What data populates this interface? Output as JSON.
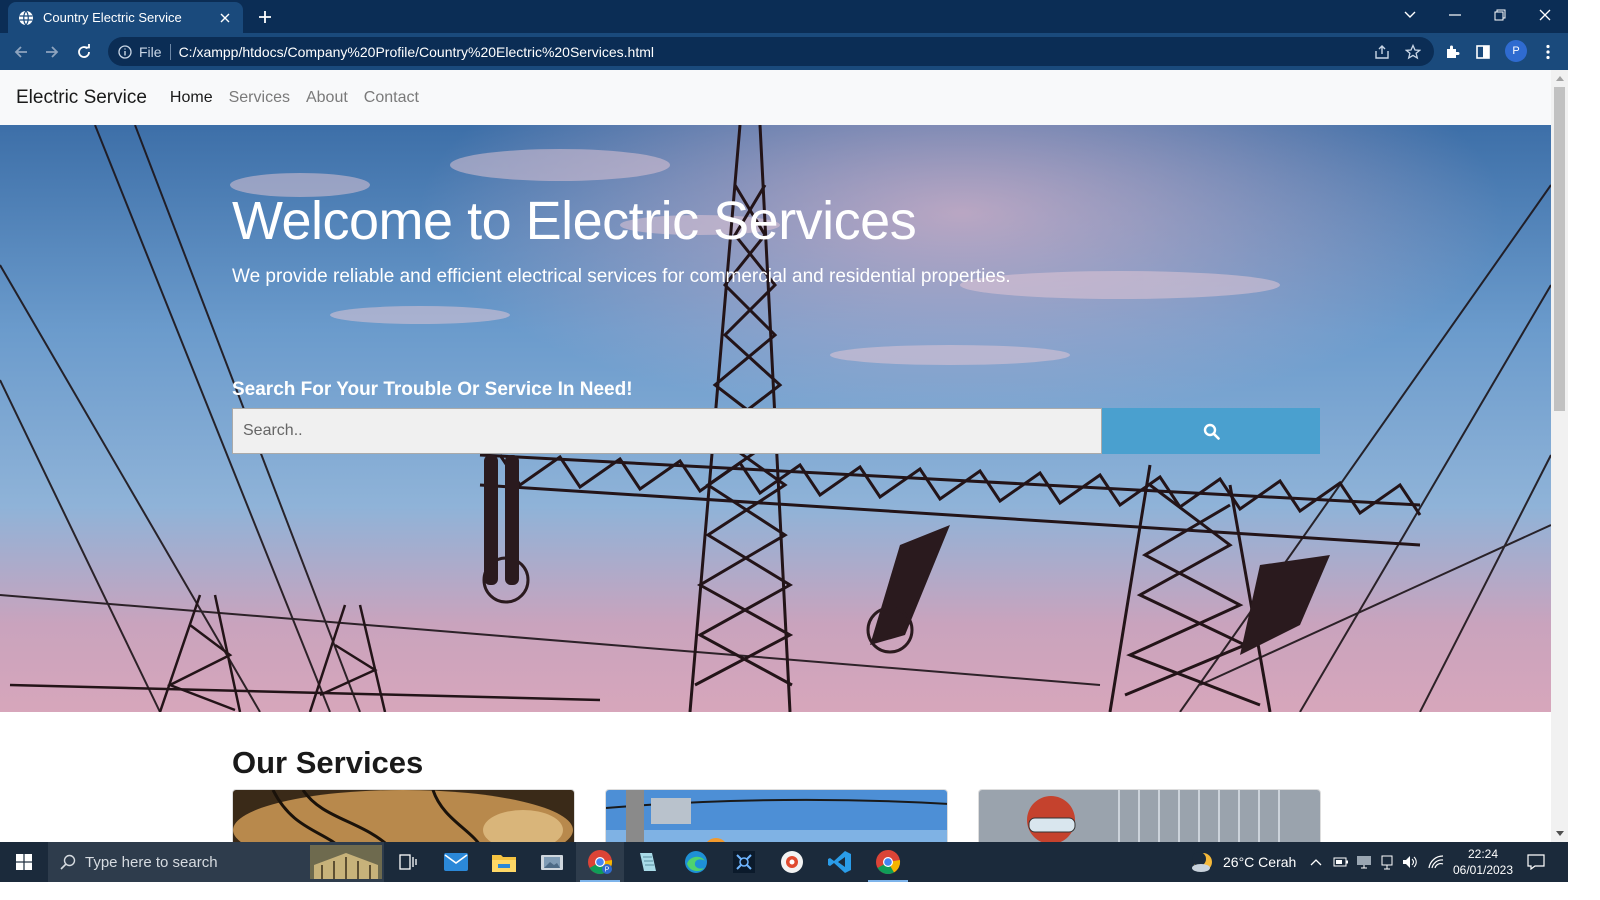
{
  "browser": {
    "tab_title": "Country Electric Service",
    "omnibox_label": "File",
    "url": "C:/xampp/htdocs/Company%20Profile/Country%20Electric%20Services.html",
    "profile_initial": "P"
  },
  "navbar": {
    "brand": "Electric Service",
    "links": [
      "Home",
      "Services",
      "About",
      "Contact"
    ],
    "active": "Home"
  },
  "hero": {
    "title": "Welcome to Electric Services",
    "subtitle": "We provide reliable and efficient electrical services for commercial and residential properties.",
    "search_label": "Search For Your Trouble Or Service In Need!",
    "search_placeholder": "Search.."
  },
  "services": {
    "title": "Our Services"
  },
  "taskbar": {
    "search_placeholder": "Type here to search",
    "weather": "26°C  Cerah",
    "time": "22:24",
    "date": "06/01/2023"
  },
  "colors": {
    "chrome_dark": "#0b2d55",
    "chrome_mid": "#1a4a7c",
    "search_button": "#4aa0cf",
    "taskbar": "#1b2a3b"
  },
  "icons": {
    "tab": "globe-icon",
    "search": "magnifier-icon",
    "apps": [
      "task-view-icon",
      "mail-icon",
      "file-explorer-icon",
      "photos-icon",
      "chrome-profile-icon",
      "notepad-icon",
      "edge-icon",
      "snipping-icon",
      "media-icon",
      "vscode-icon",
      "chrome-icon"
    ]
  }
}
